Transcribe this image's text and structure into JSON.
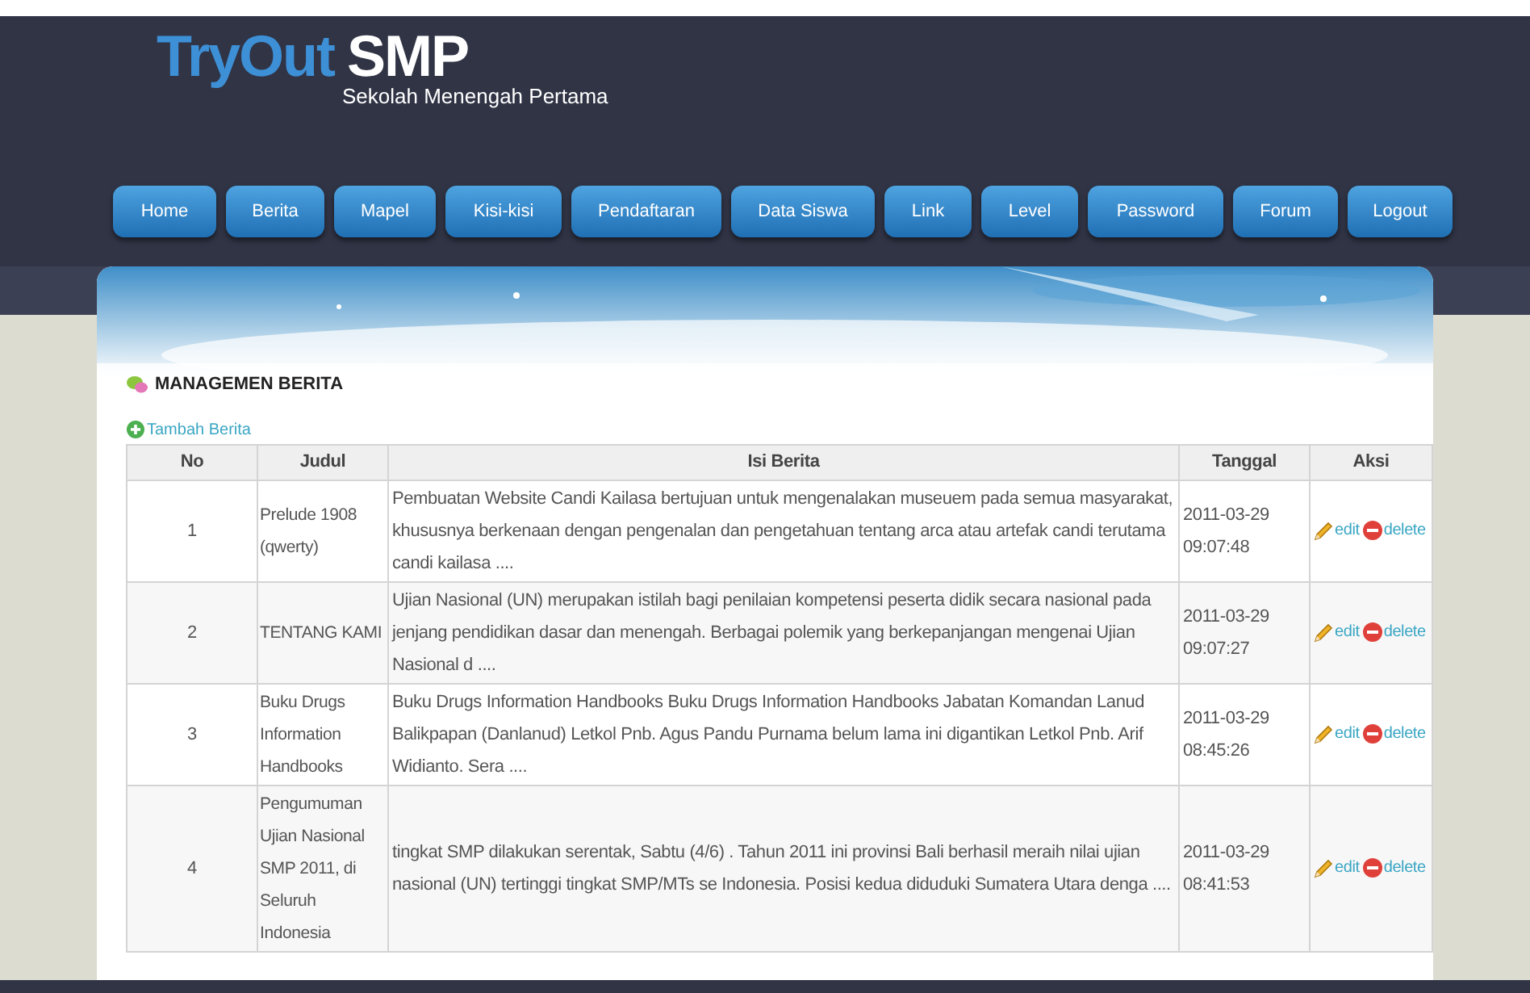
{
  "header": {
    "logo_primary": "TryOut",
    "logo_secondary": "SMP",
    "subtitle": "Sekolah Menengah Pertama"
  },
  "nav": [
    {
      "label": "Home"
    },
    {
      "label": "Berita"
    },
    {
      "label": "Mapel"
    },
    {
      "label": "Kisi-kisi"
    },
    {
      "label": "Pendaftaran"
    },
    {
      "label": "Data Siswa"
    },
    {
      "label": "Link"
    },
    {
      "label": "Level"
    },
    {
      "label": "Password"
    },
    {
      "label": "Forum"
    },
    {
      "label": "Logout"
    }
  ],
  "section": {
    "title": "MANAGEMEN BERITA",
    "add_link": "Tambah Berita"
  },
  "table": {
    "columns": [
      "No",
      "Judul",
      "Isi Berita",
      "Tanggal",
      "Aksi"
    ],
    "rows": [
      {
        "no": "1",
        "judul": "Prelude 1908 (qwerty)",
        "isi": "Pembuatan Website Candi Kailasa bertujuan untuk mengenalakan museuem pada semua masyarakat, khususnya berkenaan dengan pengenalan dan pengetahuan tentang arca atau artefak candi terutama candi kailasa ....",
        "tanggal": "2011-03-29 09:07:48",
        "actions": [
          {
            "kind": "edit",
            "label": "edit"
          },
          {
            "kind": "delete",
            "label": "delete"
          }
        ]
      },
      {
        "no": "2",
        "judul": "TENTANG KAMI",
        "isi": "Ujian Nasional (UN) merupakan istilah bagi penilaian kompetensi peserta didik secara nasional pada jenjang pendidikan dasar dan menengah. Berbagai polemik yang berkepanjangan mengenai Ujian Nasional d ....",
        "tanggal": "2011-03-29 09:07:27",
        "actions": [
          {
            "kind": "edit",
            "label": "edit"
          },
          {
            "kind": "delete",
            "label": "delete"
          }
        ]
      },
      {
        "no": "3",
        "judul": "Buku Drugs Information Handbooks",
        "isi": "Buku Drugs Information Handbooks Buku Drugs Information Handbooks Jabatan Komandan Lanud Balikpapan (Danlanud) Letkol Pnb. Agus Pandu Purnama belum lama ini digantikan Letkol Pnb. Arif Widianto. Sera ....",
        "tanggal": "2011-03-29 08:45:26",
        "actions": [
          {
            "kind": "edit",
            "label": "edit"
          },
          {
            "kind": "delete",
            "label": "delete"
          }
        ]
      },
      {
        "no": "4",
        "judul": "Pengumuman Ujian Nasional SMP 2011, di Seluruh Indonesia",
        "isi": "tingkat SMP dilakukan serentak, Sabtu (4/6) . Tahun 2011 ini provinsi Bali berhasil meraih nilai ujian nasional (UN) tertinggi tingkat SMP/MTs se Indonesia. Posisi kedua diduduki Sumatera Utara denga ....",
        "tanggal": "2011-03-29 08:41:53",
        "actions": [
          {
            "kind": "edit",
            "label": "edit"
          },
          {
            "kind": "delete",
            "label": "delete"
          }
        ]
      }
    ]
  }
}
